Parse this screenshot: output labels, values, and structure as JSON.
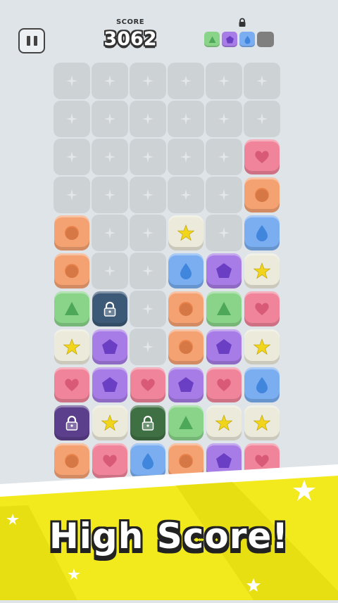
{
  "hud": {
    "score_label": "SCORE",
    "score_value": "3062",
    "pause_icon": "pause-icon",
    "next_lock_icon": "lock-icon",
    "next_pieces": [
      "triangle",
      "pentagon",
      "drop",
      "empty"
    ]
  },
  "banner": {
    "text": "High Score!",
    "color": "#f2ea1d"
  },
  "colors": {
    "orange": "#f5a273",
    "pink": "#f0849a",
    "green": "#8ad48a",
    "purple": "#a77ce6",
    "blue": "#7aaef0",
    "beige": "#eceadb",
    "locked_navy": "#3c5a78",
    "locked_purple": "#5c3f8c",
    "locked_green": "#3f7044"
  },
  "board": {
    "columns": 6,
    "rows": 11,
    "grid": [
      [
        null,
        null,
        null,
        null,
        null,
        null
      ],
      [
        null,
        null,
        null,
        null,
        null,
        null
      ],
      [
        null,
        null,
        null,
        null,
        null,
        "pink-heart"
      ],
      [
        null,
        null,
        null,
        null,
        null,
        "orange-circle"
      ],
      [
        "orange-circle",
        null,
        null,
        "beige-star",
        null,
        "blue-drop"
      ],
      [
        "orange-circle",
        null,
        null,
        "blue-drop",
        "purple-pentagon",
        "beige-star"
      ],
      [
        "green-triangle",
        "locked_navy-lock",
        null,
        "orange-circle",
        "green-triangle",
        "pink-heart"
      ],
      [
        "beige-star",
        "purple-pentagon",
        null,
        "orange-circle",
        "purple-pentagon",
        "beige-star"
      ],
      [
        "pink-heart",
        "purple-pentagon",
        "pink-heart",
        "purple-pentagon",
        "pink-heart",
        "blue-drop"
      ],
      [
        "locked_purple-lock",
        "beige-star",
        "locked_green-lock",
        "green-triangle",
        "beige-star",
        "beige-star"
      ],
      [
        "orange-circle",
        "pink-heart",
        "blue-drop",
        "orange-circle",
        "purple-pentagon",
        "pink-heart"
      ]
    ]
  }
}
